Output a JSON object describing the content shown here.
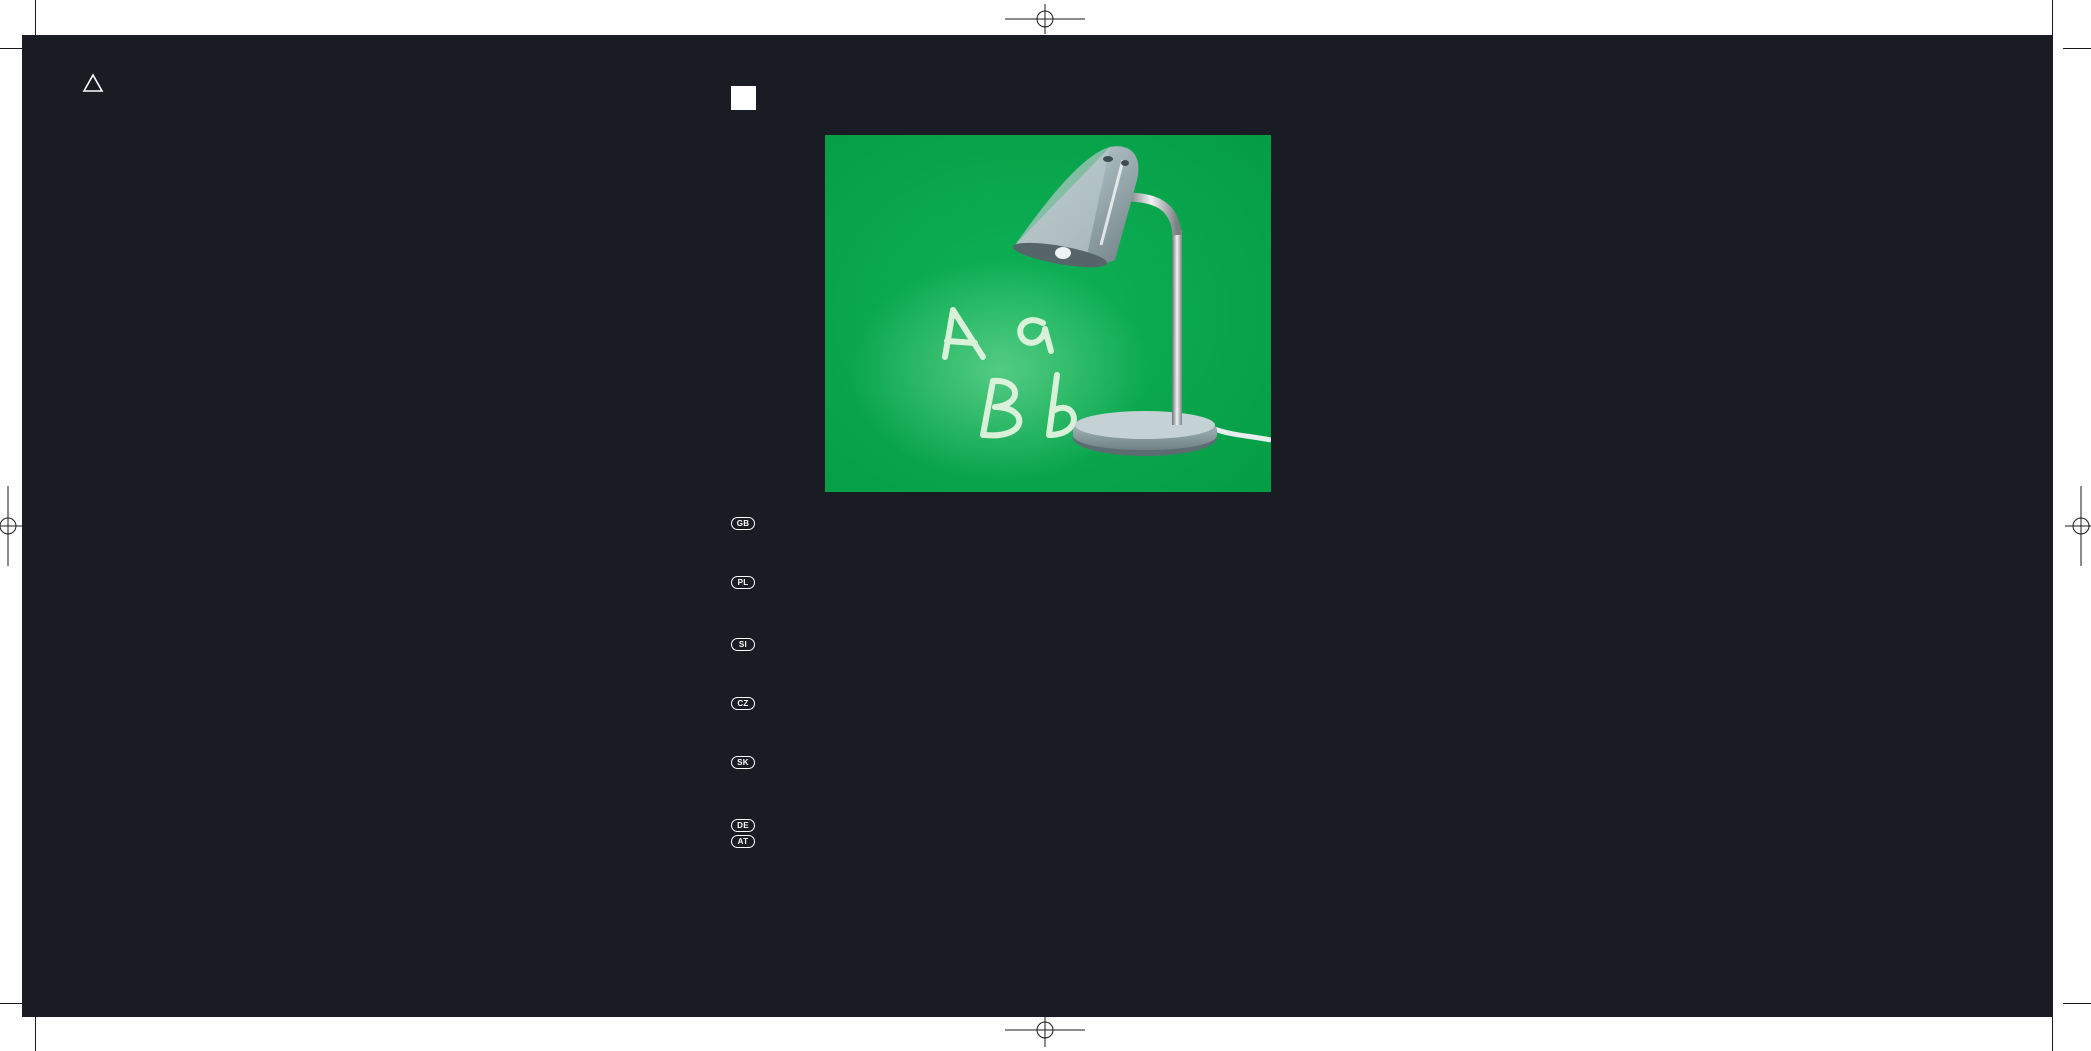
{
  "page": {
    "background": "#ffffff",
    "panel_color": "#191c23",
    "accent_green": "#06a84b"
  },
  "icons": {
    "warning": "warning-triangle-icon",
    "marker": "white-square-marker",
    "registration": "registration-mark-icon"
  },
  "country_codes": [
    "GB",
    "PL",
    "SI",
    "CZ",
    "SK",
    "DE",
    "AT"
  ],
  "cover_image": {
    "subject": "desk-lamp",
    "letters": [
      "A",
      "a",
      "B",
      "b"
    ]
  }
}
